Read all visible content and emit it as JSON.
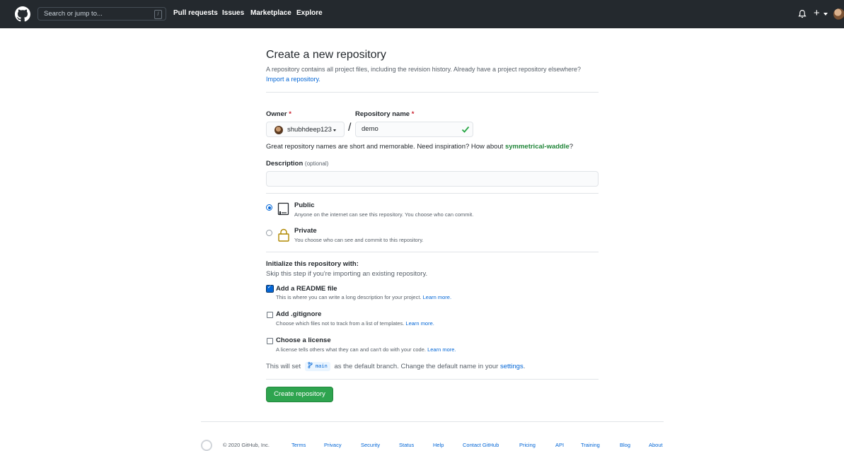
{
  "header": {
    "search_placeholder": "Search or jump to...",
    "slash_key": "/",
    "nav": [
      "Pull requests",
      "Issues",
      "Marketplace",
      "Explore"
    ],
    "plus": "+"
  },
  "page": {
    "title": "Create a new repository",
    "subtitle": "A repository contains all project files, including the revision history. Already have a project repository elsewhere?",
    "import_link": "Import a repository."
  },
  "form": {
    "owner_label": "Owner",
    "required_mark": "*",
    "owner_value": "shubhdeep123",
    "separator": "/",
    "repo_label": "Repository name",
    "repo_value": "demo",
    "hint_text": "Great repository names are short and memorable. Need inspiration? How about",
    "hint_suggestion": "symmetrical-waddle",
    "hint_end": "?",
    "description_label": "Description",
    "description_optional": "(optional)",
    "description_value": ""
  },
  "visibility": {
    "public_title": "Public",
    "public_desc": "Anyone on the internet can see this repository. You choose who can commit.",
    "private_title": "Private",
    "private_desc": "You choose who can see and commit to this repository.",
    "selected": "Public"
  },
  "init": {
    "title": "Initialize this repository with:",
    "subtitle": "Skip this step if you're importing an existing repository.",
    "readme_title": "Add a README file",
    "readme_desc": "This is where you can write a long description for your project.",
    "readme_checked": true,
    "gitignore_title": "Add .gitignore",
    "gitignore_desc": "Choose which files not to track from a list of templates.",
    "gitignore_checked": false,
    "license_title": "Choose a license",
    "license_desc": "A license tells others what they can and can't do with your code.",
    "license_checked": false,
    "learn_more": "Learn more."
  },
  "branch": {
    "prefix": "This will set",
    "name": "main",
    "suffix": "as the default branch. Change the default name in your",
    "settings_link": "settings",
    "end": "."
  },
  "submit_label": "Create repository",
  "footer": {
    "copyright": "© 2020 GitHub, Inc.",
    "links": [
      "Terms",
      "Privacy",
      "Security",
      "Status",
      "Help",
      "Contact GitHub",
      "Pricing",
      "API",
      "Training",
      "Blog",
      "About"
    ]
  },
  "colors": {
    "header_bg": "#24292e",
    "link": "#0366d6",
    "primary_button": "#2ea44f",
    "success": "#22863a",
    "required": "#cb2431"
  }
}
